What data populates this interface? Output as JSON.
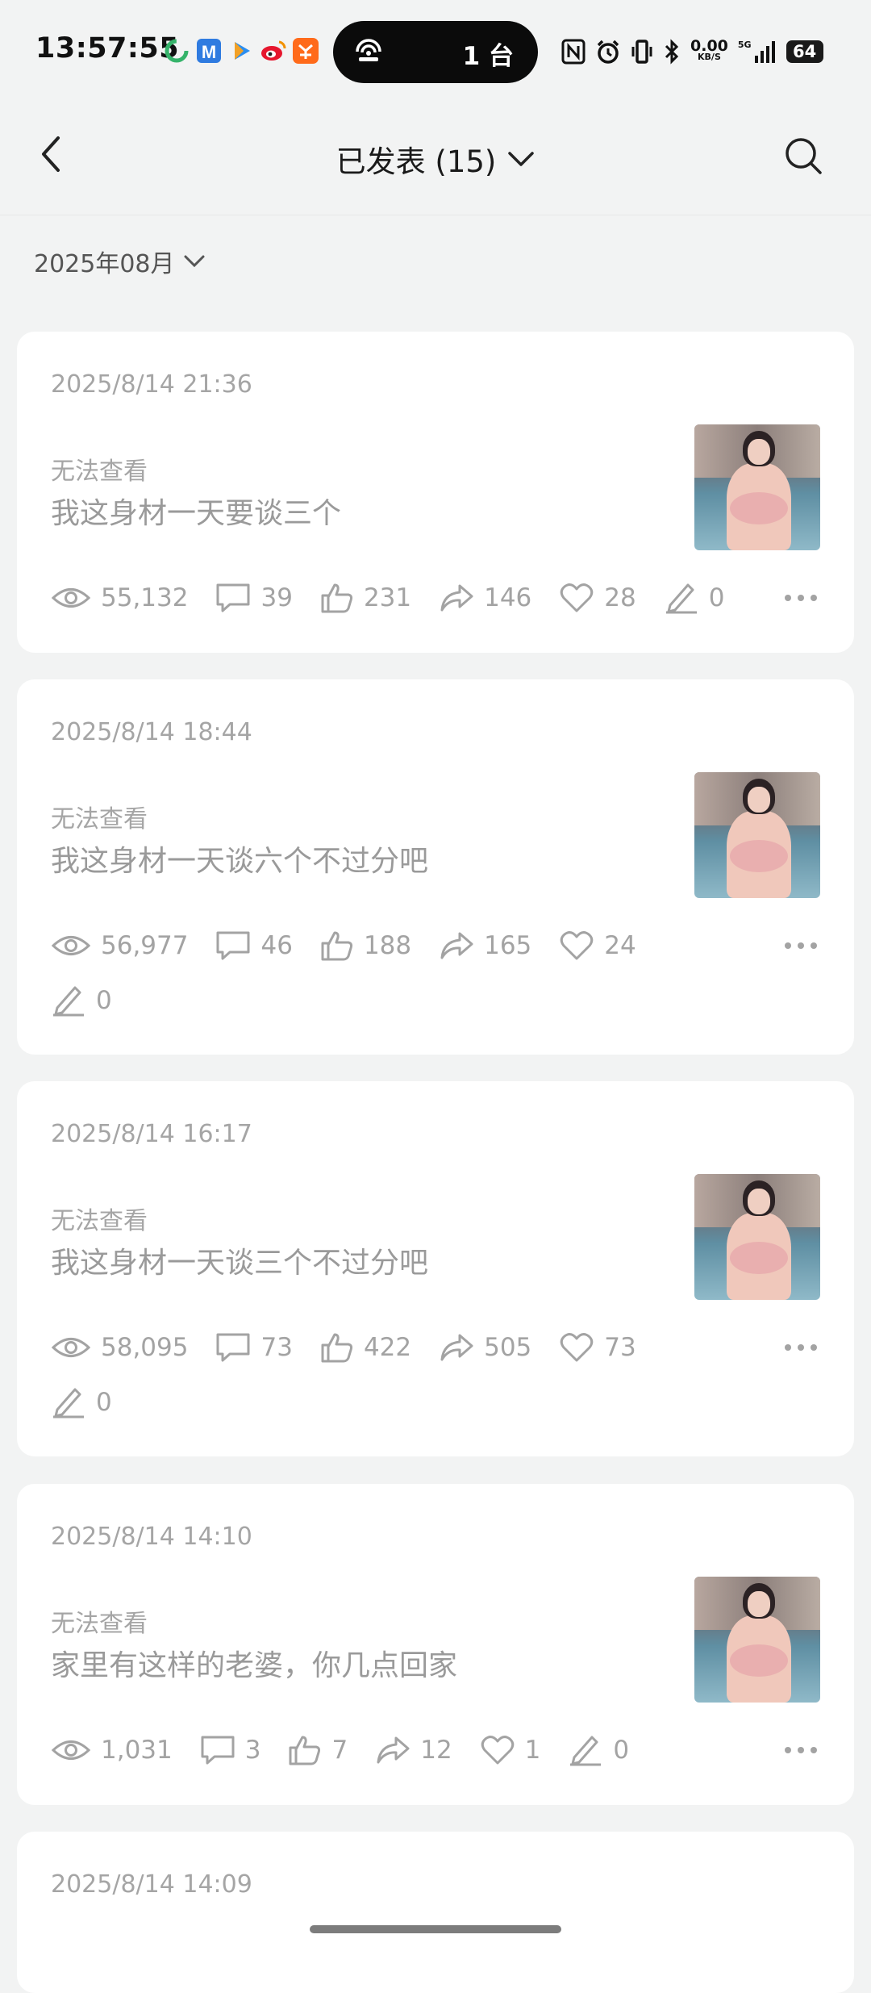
{
  "status_bar": {
    "time": "13:57:55",
    "pill_text": "1 台",
    "net_speed": "0.00",
    "net_unit": "KB/S",
    "net_type": "5G",
    "battery": "64",
    "app_icons": [
      "360-icon",
      "metro-icon",
      "play-icon",
      "weibo-icon",
      "taobao-icon"
    ]
  },
  "header": {
    "title": "已发表 (15)"
  },
  "filter": {
    "month": "2025年08月"
  },
  "posts": [
    {
      "time": "2025/8/14 21:36",
      "status": "无法查看",
      "text": "我这身材一天要谈三个",
      "views": "55,132",
      "comments": "39",
      "likes": "231",
      "shares": "146",
      "favorites": "28",
      "edits": "0"
    },
    {
      "time": "2025/8/14 18:44",
      "status": "无法查看",
      "text": "我这身材一天谈六个不过分吧",
      "views": "56,977",
      "comments": "46",
      "likes": "188",
      "shares": "165",
      "favorites": "24",
      "edits": "0"
    },
    {
      "time": "2025/8/14 16:17",
      "status": "无法查看",
      "text": "我这身材一天谈三个不过分吧",
      "views": "58,095",
      "comments": "73",
      "likes": "422",
      "shares": "505",
      "favorites": "73",
      "edits": "0"
    },
    {
      "time": "2025/8/14 14:10",
      "status": "无法查看",
      "text": "家里有这样的老婆，你几点回家",
      "views": "1,031",
      "comments": "3",
      "likes": "7",
      "shares": "12",
      "favorites": "1",
      "edits": "0"
    },
    {
      "time": "2025/8/14 14:09"
    }
  ],
  "colors": {
    "background": "#f2f3f3",
    "card": "#ffffff",
    "muted_text": "#a3a3a3"
  }
}
